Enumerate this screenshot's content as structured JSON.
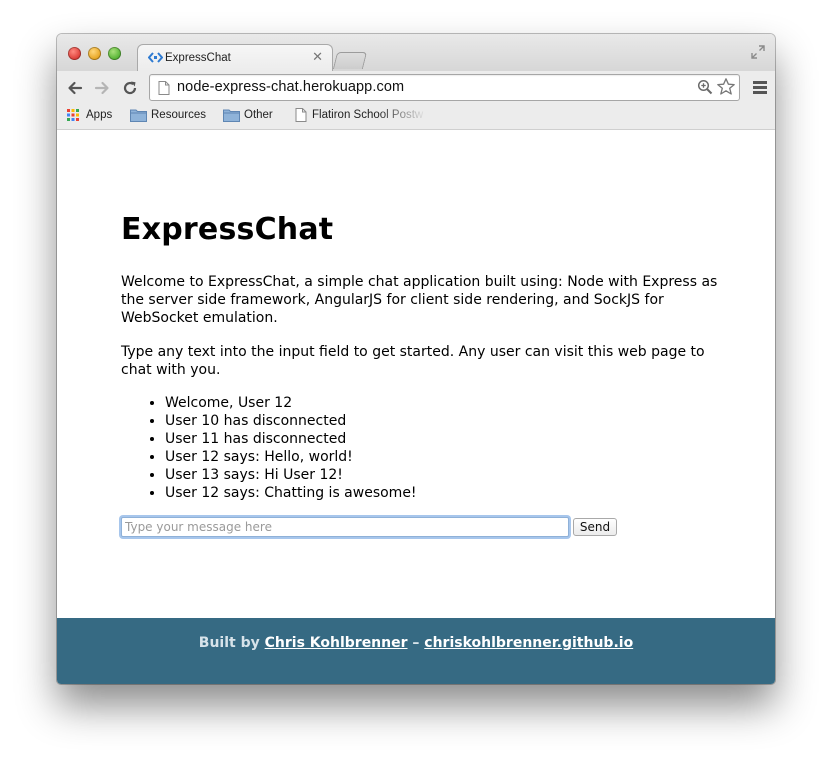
{
  "browser": {
    "tab": {
      "title": "ExpressChat",
      "favicon_icon": "chevron-pair-icon"
    },
    "url": "node-express-chat.herokuapp.com",
    "bookmarks": [
      {
        "label": "Apps",
        "icon": "apps-grid-icon"
      },
      {
        "label": "Resources",
        "icon": "folder-icon"
      },
      {
        "label": "Other",
        "icon": "folder-icon"
      },
      {
        "label": "Flatiron School Postw",
        "icon": "page-icon"
      }
    ]
  },
  "page": {
    "heading": "ExpressChat",
    "intro": "Welcome to ExpressChat, a simple chat application built using: Node with Express as the server side framework, AngularJS for client side rendering, and SockJS for WebSocket emulation.",
    "instructions": "Type any text into the input field to get started. Any user can visit this web page to chat with you.",
    "messages": [
      "Welcome, User 12",
      "User 10 has disconnected",
      "User 11 has disconnected",
      "User 12 says: Hello, world!",
      "User 13 says: Hi User 12!",
      "User 12 says: Chatting is awesome!"
    ],
    "input_placeholder": "Type your message here",
    "input_value": "",
    "send_label": "Send"
  },
  "footer": {
    "prefix": "Built by",
    "author_link": "Chris Kohlbrenner",
    "separator": "–",
    "site_link": "chriskohlbrenner.github.io"
  },
  "colors": {
    "footer_bg": "#366a83",
    "focus_ring": "#a7c6ec"
  }
}
